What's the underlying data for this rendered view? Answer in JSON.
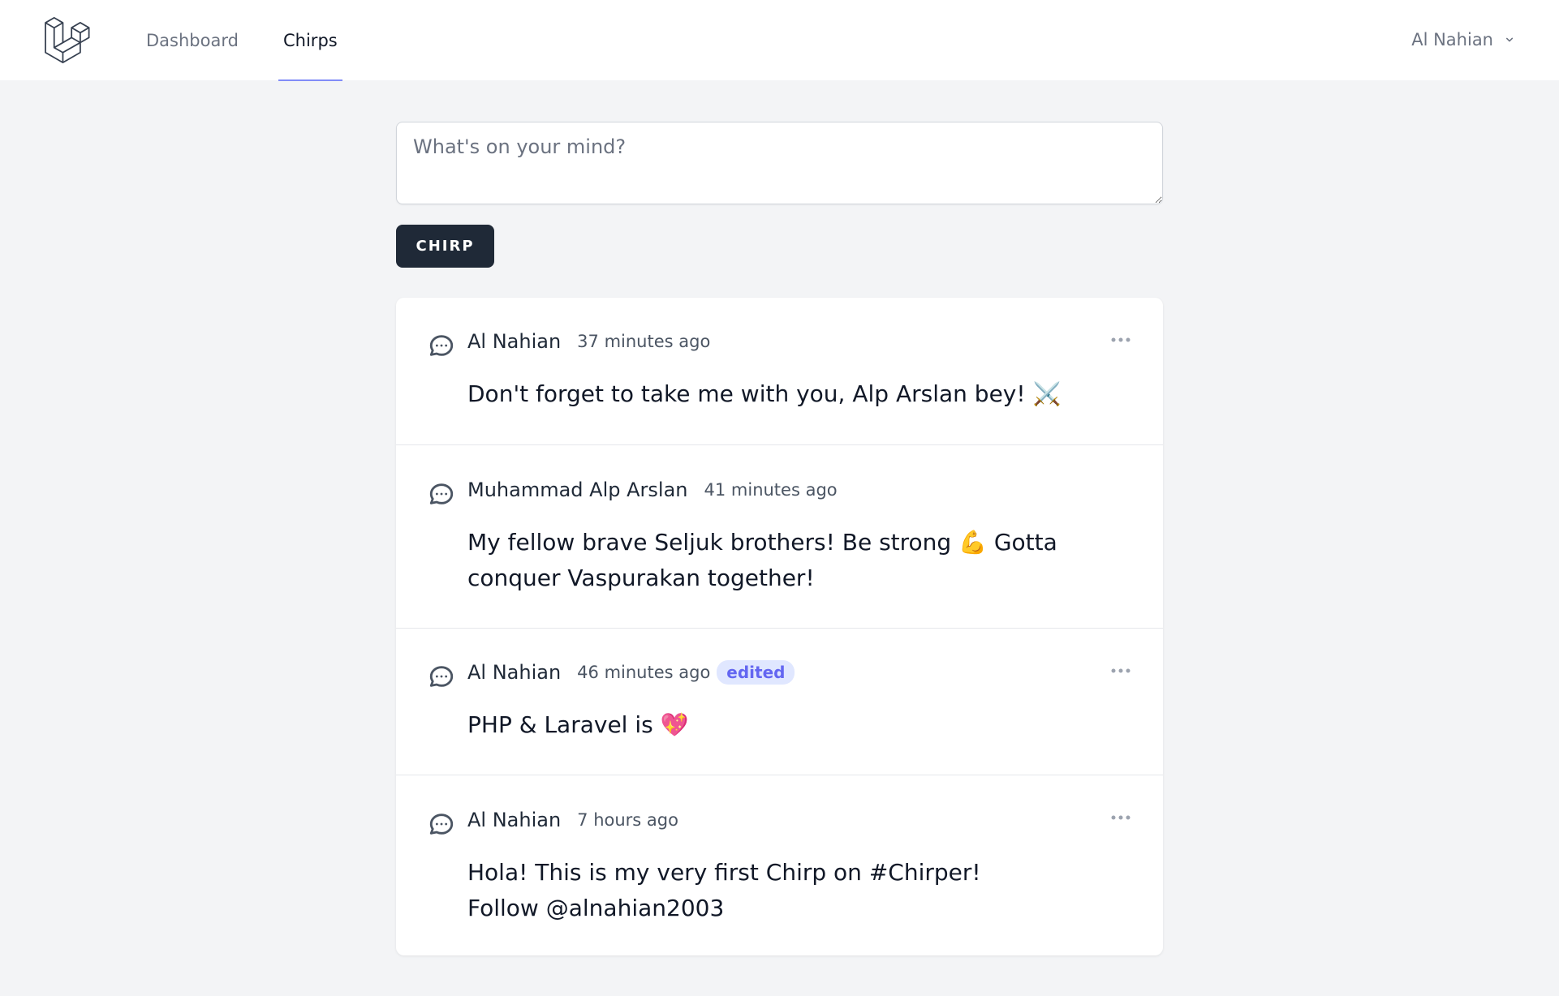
{
  "nav": {
    "links": [
      {
        "label": "Dashboard",
        "active": false
      },
      {
        "label": "Chirps",
        "active": true
      }
    ],
    "user": {
      "name": "Al Nahian"
    }
  },
  "composer": {
    "placeholder": "What's on your mind?",
    "value": "",
    "submit_label": "CHIRP"
  },
  "chirps": [
    {
      "author": "Al Nahian",
      "time": "37 minutes ago",
      "edited": false,
      "message": "Don't forget to take me with you, Alp Arslan bey! ⚔️",
      "has_menu": true
    },
    {
      "author": "Muhammad Alp Arslan",
      "time": "41 minutes ago",
      "edited": false,
      "message": "My fellow brave Seljuk brothers! Be strong 💪 Gotta conquer Vaspurakan together!",
      "has_menu": false
    },
    {
      "author": "Al Nahian",
      "time": "46 minutes ago",
      "edited": true,
      "edited_label": "edited",
      "message": "PHP & Laravel is 💖",
      "has_menu": true
    },
    {
      "author": "Al Nahian",
      "time": "7 hours ago",
      "edited": false,
      "message": "Hola! This is my very first Chirp on #Chirper! Follow @alnahian2003",
      "has_menu": true
    }
  ],
  "colors": {
    "accent": "#818cf8",
    "button_bg": "#1f2937",
    "badge_text": "#6366f1",
    "page_bg": "#f3f4f6"
  },
  "icons": [
    "laravel-logo-icon",
    "chevron-down-icon",
    "chat-bubble-icon",
    "more-dots-icon"
  ]
}
